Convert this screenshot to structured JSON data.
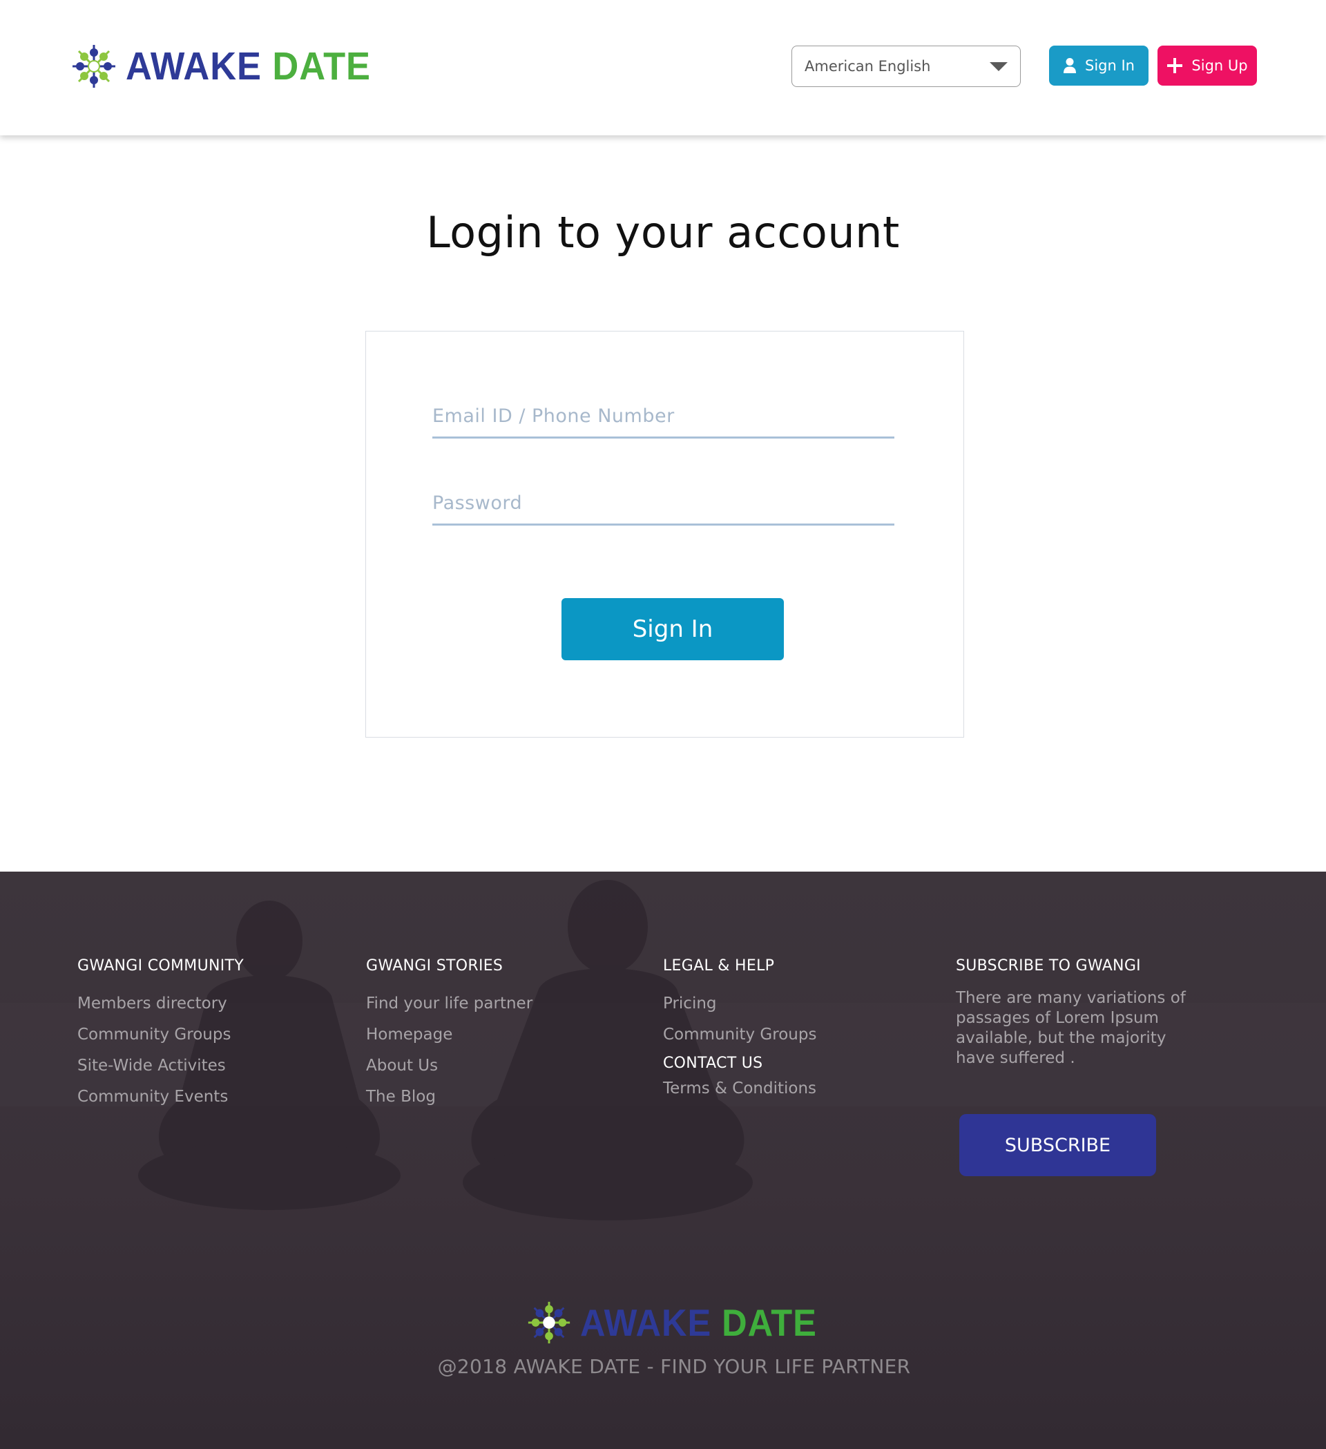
{
  "header": {
    "logo": {
      "word1": "AWAKE",
      "word2": "DATE"
    },
    "language_select": {
      "value": "American English"
    },
    "signin_label": "Sign In",
    "signup_label": "Sign Up"
  },
  "main": {
    "title": "Login to your account",
    "email": {
      "placeholder": "Email ID / Phone Number",
      "value": ""
    },
    "password": {
      "placeholder": "Password",
      "value": ""
    },
    "signin_button_label": "Sign In"
  },
  "footer": {
    "community": {
      "heading": "GWANGI COMMUNITY",
      "links": [
        "Members directory",
        "Community Groups",
        "Site-Wide Activites",
        "Community Events"
      ]
    },
    "stories": {
      "heading": "GWANGI STORIES",
      "links": [
        "Find your life partner",
        "Homepage",
        "About Us",
        "The Blog"
      ]
    },
    "legal": {
      "heading": "LEGAL & HELP",
      "links": [
        "Pricing",
        "Community Groups"
      ],
      "contact_heading": "CONTACT US",
      "contact_links": [
        "Terms & Conditions"
      ]
    },
    "subscribe": {
      "heading": "SUBSCRIBE TO GWANGI",
      "text": "There are many variations of passages of Lorem Ipsum available, but the majority have suffered .",
      "button_label": "SUBSCRIBE"
    },
    "logo": {
      "word1": "AWAKE",
      "word2": "DATE"
    },
    "copyright": "@2018 AWAKE DATE - FIND YOUR LIFE PARTNER"
  },
  "colors": {
    "signin_blue": "#1a9bc7",
    "signup_pink": "#ee1163",
    "subscribe_indigo": "#2f3595",
    "logo_blue": "#2e3a97",
    "logo_green": "#4caf3f",
    "footer_bg": "#332b33"
  },
  "icons": {
    "logo": "flower-burst-icon",
    "language_caret": "caret-down-icon",
    "signin": "user-icon",
    "signup": "plus-icon"
  }
}
